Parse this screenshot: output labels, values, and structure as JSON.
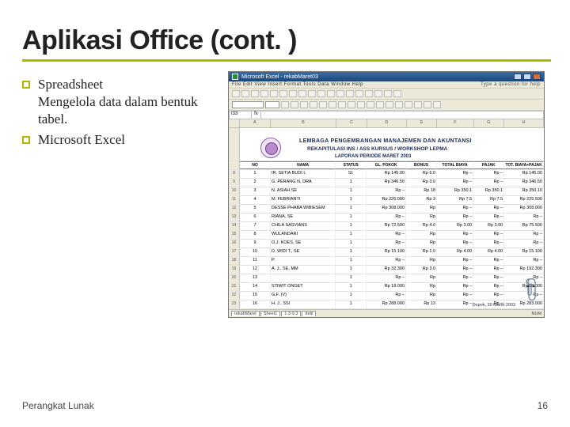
{
  "slide": {
    "title": "Aplikasi Office (cont. )",
    "bullets": [
      {
        "heading": "Spreadsheet",
        "sub": "Mengelola data dalam bentuk tabel."
      },
      {
        "heading": "Microsoft Excel",
        "sub": ""
      }
    ],
    "footer_left": "Perangkat Lunak",
    "footer_right": "16"
  },
  "excel": {
    "title": "Microsoft Excel - rekabMaret03",
    "help_hint": "Type a question for help",
    "menu": "File  Edit  View  Insert  Format  Tools  Data  Window  Help",
    "namebox": "I33",
    "fx": "fx",
    "col_letters": [
      "A",
      "B",
      "C",
      "D",
      "E",
      "F",
      "G",
      "H"
    ],
    "doc_title1": "LEMBAGA PENGEMBANGAN MANAJEMEN DAN AKUNTANSI",
    "doc_title2": "REKAPITULASI INS / ASS KURSUS / WORKSHOP LEPMA",
    "doc_title3": "LAPORAN PERIODE MARET 2003",
    "table_header": [
      "NO",
      "NAMA",
      "STATUS",
      "GL. POKOK",
      "BONUS",
      "TOTAL BIAYA",
      "PAJAK",
      "TOT. BIAYA+PAJAK"
    ],
    "rows": [
      [
        "1",
        "IR. SETIA BUDI L",
        "SI.",
        "Rp  145.00",
        "Rp  6.0",
        "Rp  –",
        "Rp  145.00"
      ],
      [
        "2",
        "G. PERANG N, DRA",
        "1",
        "Rp  346.50",
        "Rp  3.0",
        "Rp  –",
        "Rp  346.50"
      ],
      [
        "3",
        "N. ASIAH SE",
        "1",
        "Rp  –",
        "Rp  18",
        "Rp  350.1",
        "Rp  350.10"
      ],
      [
        "4",
        "M. FEBRIANTI",
        "1",
        "Rp  226.000",
        "Rp  3",
        "Rp  7.5",
        "Rp  225.500"
      ],
      [
        "5",
        "DESSE PHABA WIBIESEM",
        "1",
        "Rp  308.000",
        "Rp",
        "Rp  –",
        "Rp  308.000"
      ],
      [
        "6",
        "RIANA, SE",
        "1",
        "Rp  –",
        "Rp",
        "Rp  –",
        "Rp  –"
      ],
      [
        "7",
        "CHILA SASVIANS",
        "1",
        "Rp  72.500",
        "Rp  4.0",
        "Rp  3.00",
        "Rp  75.500"
      ],
      [
        "8",
        "WULANDARI",
        "1",
        "Rp  –",
        "Rp",
        "Rp  –",
        "Rp  –"
      ],
      [
        "9",
        "O.J. KOES, SE",
        "1",
        "Rp  –",
        "Rp",
        "Rp  –",
        "Rp  –"
      ],
      [
        "10",
        "D. WIDI T., SE",
        "1",
        "Rp  15.100",
        "Rp  1.0",
        "Rp  4.00",
        "Rp  15.100"
      ],
      [
        "11",
        "P.",
        "1",
        "Rp  –",
        "Rp",
        "Rp  –",
        "Rp  –"
      ],
      [
        "12",
        "A. J., SE, MM",
        "1",
        "Rp  32.300",
        "Rp  3.0",
        "Rp  –",
        "Rp  192.300"
      ],
      [
        "13",
        "",
        "1",
        "Rp  –",
        "Rp",
        "Rp  –",
        "Rp  –"
      ],
      [
        "14",
        "STIWIT ONGET",
        "1",
        "Rp  18.000",
        "Rp",
        "Rp  –",
        "Rp  18.000"
      ],
      [
        "15",
        "G.F. (V)",
        "1",
        "Rp  –",
        "Rp",
        "Rp  –",
        "Rp  –"
      ],
      [
        "16",
        "H. J., SSI",
        "1",
        "Rp  288.000",
        "Rp  13",
        "Rp  –",
        "Rp  283.000"
      ]
    ],
    "note": "Depok, 30 Maret 2003",
    "sheets": [
      "rekabMaret",
      "Sheet1",
      "1.3-9.3",
      "detil"
    ],
    "status_right": "NUM"
  }
}
